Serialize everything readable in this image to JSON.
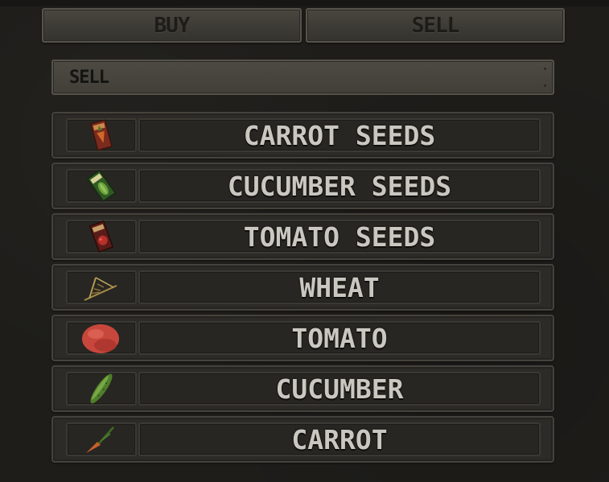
{
  "tabs": {
    "buy_label": "BUY",
    "sell_label": "SELL"
  },
  "header": {
    "title": "SELL"
  },
  "items": [
    {
      "name": "CARROT SEEDS",
      "icon": "carrot-seeds-icon"
    },
    {
      "name": "CUCUMBER SEEDS",
      "icon": "cucumber-seeds-icon"
    },
    {
      "name": "TOMATO SEEDS",
      "icon": "tomato-seeds-icon"
    },
    {
      "name": "WHEAT",
      "icon": "wheat-icon"
    },
    {
      "name": "TOMATO",
      "icon": "tomato-icon"
    },
    {
      "name": "CUCUMBER",
      "icon": "cucumber-icon"
    },
    {
      "name": "CARROT",
      "icon": "carrot-icon"
    }
  ],
  "colors": {
    "background": "#1e1d1a",
    "panel": "#2c2b27",
    "text": "#c9c7c0",
    "tab_text": "#1d1c19"
  }
}
